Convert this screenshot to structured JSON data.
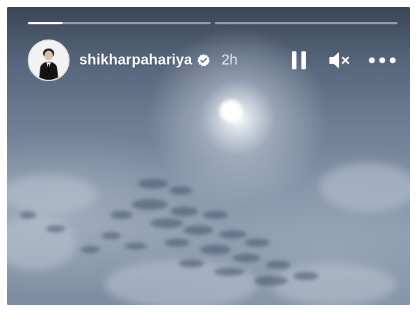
{
  "story": {
    "username": "shikharpahariya",
    "time_ago": "2h",
    "verified": true,
    "progress": [
      {
        "segment": 1,
        "fraction": 0.19
      },
      {
        "segment": 2,
        "fraction": 0.0
      }
    ]
  },
  "icons": {
    "avatar": "profile-photo",
    "verified": "verified-badge-icon",
    "pause": "pause-icon",
    "mute": "speaker-muted-icon",
    "more": "more-horizontal-icon"
  },
  "colors": {
    "text": "#ffffff",
    "progress_track": "rgba(255,255,255,0.45)",
    "progress_fill": "#ffffff",
    "sky_dark": "#3b4656",
    "sky_light": "#8796aa"
  }
}
